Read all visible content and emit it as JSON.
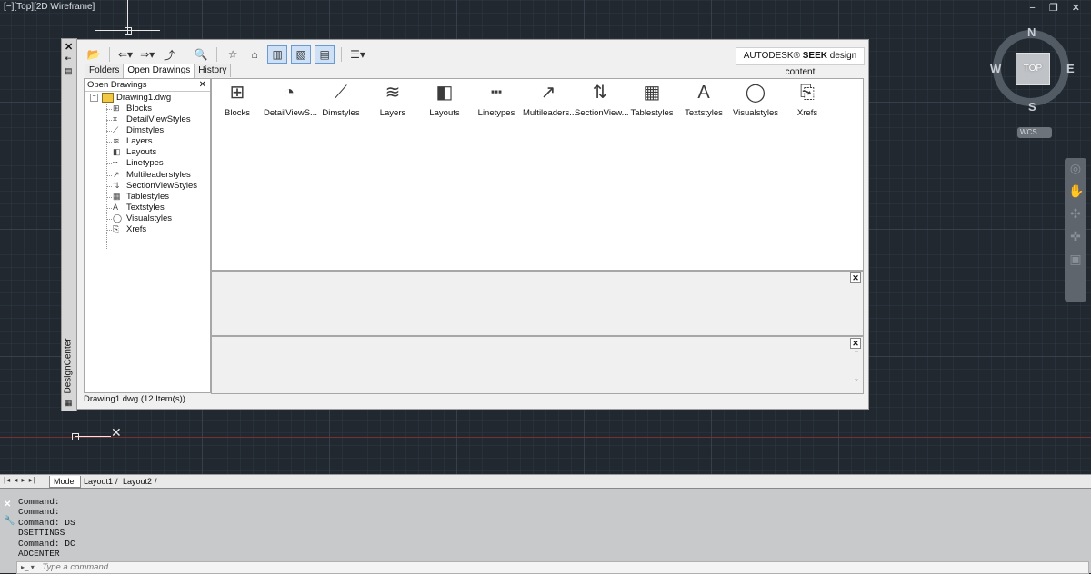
{
  "viewport": {
    "label": "[−][Top][2D Wireframe]",
    "window_controls": [
      "−",
      "❐",
      "✕"
    ]
  },
  "viewcube": {
    "north": "N",
    "south": "S",
    "east": "E",
    "west": "W",
    "top": "TOP",
    "wcs": "WCS"
  },
  "designcenter": {
    "title": "DesignCenter",
    "tabs": [
      "Folders",
      "Open Drawings",
      "History"
    ],
    "active_tab": "Open Drawings",
    "seek": {
      "brand": "AUTODESK®",
      "name": "SEEK",
      "suffix": "design content"
    },
    "tree": {
      "header": "Open Drawings",
      "root": "Drawing1.dwg",
      "items": [
        "Blocks",
        "DetailViewStyles",
        "Dimstyles",
        "Layers",
        "Layouts",
        "Linetypes",
        "Multileaderstyles",
        "SectionViewStyles",
        "Tablestyles",
        "Textstyles",
        "Visualstyles",
        "Xrefs"
      ]
    },
    "content_items": [
      "Blocks",
      "DetailViewS...",
      "Dimstyles",
      "Layers",
      "Layouts",
      "Linetypes",
      "Multileaders...",
      "SectionView...",
      "Tablestyles",
      "Textstyles",
      "Visualstyles",
      "Xrefs"
    ],
    "status": "Drawing1.dwg (12 Item(s))"
  },
  "layout_tabs": [
    "Model",
    "Layout1",
    "Layout2"
  ],
  "command": {
    "history": [
      "Command:",
      "Command:",
      "Command: DS",
      "DSETTINGS",
      "Command: DC",
      "ADCENTER"
    ],
    "placeholder": "Type a command"
  }
}
